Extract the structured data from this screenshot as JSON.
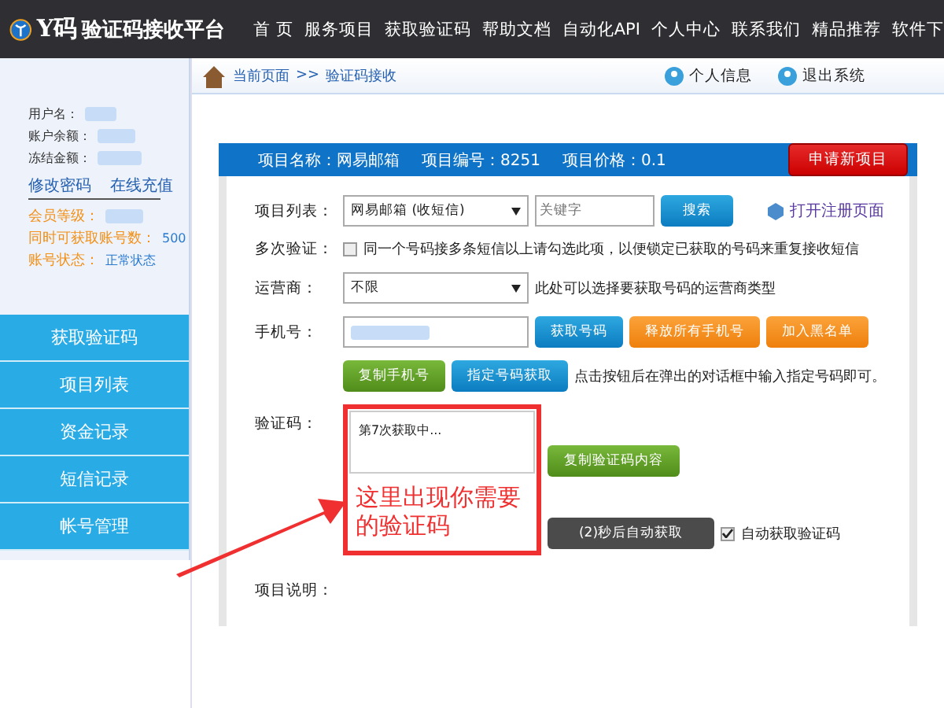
{
  "header": {
    "logo_mark": "Y码",
    "title": "验证码接收平台",
    "nav": [
      {
        "label": "首 页",
        "selected": false
      },
      {
        "label": "服务项目",
        "selected": false
      },
      {
        "label": "获取验证码",
        "selected": false
      },
      {
        "label": "帮助文档",
        "selected": false
      },
      {
        "label": "自动化API",
        "selected": false
      },
      {
        "label": "个人中心",
        "selected": false
      },
      {
        "label": "联系我们",
        "selected": false
      },
      {
        "label": "精品推荐",
        "selected": false
      },
      {
        "label": "软件下",
        "selected": false
      }
    ]
  },
  "breadcrumb": {
    "home": "当前页面",
    "separator": ">>",
    "current": "验证码接收",
    "links": [
      "个人信息",
      "退出系统"
    ]
  },
  "sidebar": {
    "account": [
      {
        "label": "用户名："
      },
      {
        "label": "账户余额："
      },
      {
        "label": "冻结金额："
      }
    ],
    "links": [
      "修改密码",
      "在线充值"
    ],
    "status": [
      {
        "label": "会员等级：",
        "kind": "blurred"
      },
      {
        "label": "同时可获取账号数：",
        "value": "500",
        "kind": "text"
      },
      {
        "label": "账号状态：",
        "value": "正常状态",
        "kind": "text"
      }
    ],
    "menu": [
      {
        "label": "获取验证码",
        "selected": false
      },
      {
        "label": "项目列表",
        "selected": false
      },
      {
        "label": "资金记录",
        "selected": false
      },
      {
        "label": "短信记录",
        "selected": false
      },
      {
        "label": "帐号管理",
        "selected": false
      }
    ]
  },
  "panel": {
    "info": [
      "项目名称：网易邮箱",
      "项目编号：8251",
      "项目价格：0.1"
    ],
    "new_button": "申请新项目",
    "project": {
      "label": "项目列表：",
      "select": "网易邮箱 (收短信)",
      "placeholder": "关键字",
      "search": "搜索",
      "open_link": "打开注册页面"
    },
    "multi": {
      "label": "多次验证：",
      "checked": false,
      "text": "同一个号码接多条短信以上请勾选此项，以便锁定已获取的号码来重复接收短信"
    },
    "carrier": {
      "label": "运营商：",
      "select": "不限",
      "hint": "此处可以选择要获取号码的运营商类型"
    },
    "phone": {
      "label": "手机号：",
      "buttons": [
        {
          "label": "获取号码",
          "kind": "blue"
        },
        {
          "label": "释放所有手机号",
          "kind": "orange"
        },
        {
          "label": "加入黑名单",
          "kind": "orange"
        }
      ]
    },
    "phone_actions": {
      "buttons": [
        {
          "label": "复制手机号",
          "kind": "green"
        },
        {
          "label": "指定号码获取",
          "kind": "blue"
        }
      ],
      "hint": "点击按钮后在弹出的对话框中输入指定号码即可。"
    },
    "code": {
      "label": "验证码：",
      "value": "第7次获取中...",
      "copy": "复制验证码内容",
      "countdown": "(2)秒后自动获取",
      "auto_checked": true,
      "auto_label": "自动获取验证码"
    },
    "description": {
      "label": "项目说明："
    }
  },
  "annotation": {
    "text": "这里出现你需要的验证码"
  }
}
